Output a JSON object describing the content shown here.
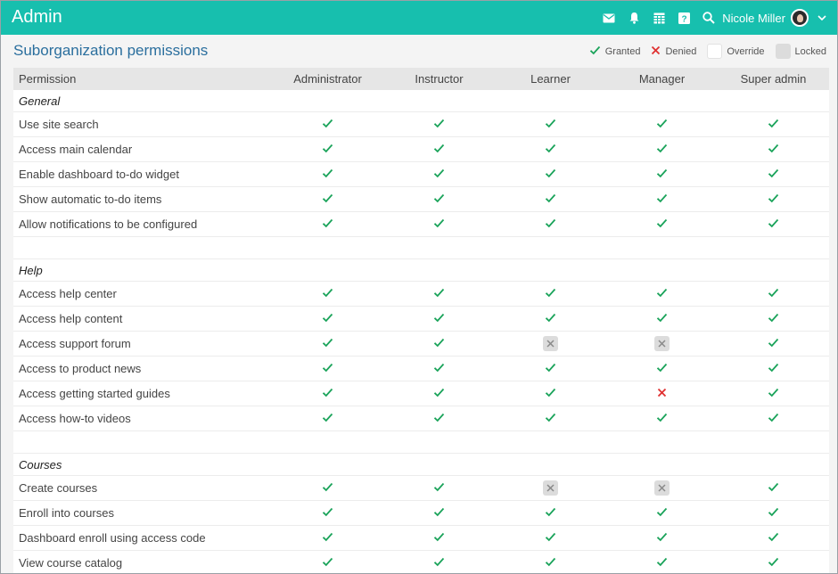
{
  "app": {
    "title": "Admin"
  },
  "header": {
    "icons": [
      "mail-icon",
      "bell-icon",
      "calendar-icon",
      "help-icon",
      "search-icon"
    ],
    "user_name": "Nicole Miller"
  },
  "page": {
    "title": "Suborganization permissions"
  },
  "legend": {
    "granted": "Granted",
    "denied": "Denied",
    "override": "Override",
    "locked": "Locked"
  },
  "colors": {
    "accent": "#17bfae",
    "title": "#2b6f9e",
    "granted": "#1aa35a",
    "denied": "#e03030",
    "locked": "#dcdcdc"
  },
  "table": {
    "header_permission": "Permission",
    "roles": [
      "Administrator",
      "Instructor",
      "Learner",
      "Manager",
      "Super admin"
    ],
    "sections": [
      {
        "name": "General",
        "rows": [
          {
            "label": "Use site search",
            "values": [
              "granted",
              "granted",
              "granted",
              "granted",
              "granted"
            ]
          },
          {
            "label": "Access main calendar",
            "values": [
              "granted",
              "granted",
              "granted",
              "granted",
              "granted"
            ]
          },
          {
            "label": "Enable dashboard to-do widget",
            "values": [
              "granted",
              "granted",
              "granted",
              "granted",
              "granted"
            ]
          },
          {
            "label": "Show automatic to-do items",
            "values": [
              "granted",
              "granted",
              "granted",
              "granted",
              "granted"
            ]
          },
          {
            "label": "Allow notifications to be configured",
            "values": [
              "granted",
              "granted",
              "granted",
              "granted",
              "granted"
            ]
          }
        ]
      },
      {
        "name": "Help",
        "rows": [
          {
            "label": "Access help center",
            "values": [
              "granted",
              "granted",
              "granted",
              "granted",
              "granted"
            ]
          },
          {
            "label": "Access help content",
            "values": [
              "granted",
              "granted",
              "granted",
              "granted",
              "granted"
            ]
          },
          {
            "label": "Access support forum",
            "values": [
              "granted",
              "granted",
              "locked",
              "locked",
              "granted"
            ]
          },
          {
            "label": "Access to product news",
            "values": [
              "granted",
              "granted",
              "granted",
              "granted",
              "granted"
            ]
          },
          {
            "label": "Access getting started guides",
            "values": [
              "granted",
              "granted",
              "granted",
              "denied",
              "granted"
            ]
          },
          {
            "label": "Access how-to videos",
            "values": [
              "granted",
              "granted",
              "granted",
              "granted",
              "granted"
            ]
          }
        ]
      },
      {
        "name": "Courses",
        "rows": [
          {
            "label": "Create courses",
            "values": [
              "granted",
              "granted",
              "locked",
              "locked",
              "granted"
            ]
          },
          {
            "label": "Enroll into courses",
            "values": [
              "granted",
              "granted",
              "granted",
              "granted",
              "granted"
            ]
          },
          {
            "label": "Dashboard enroll using access code",
            "values": [
              "granted",
              "granted",
              "granted",
              "granted",
              "granted"
            ]
          },
          {
            "label": "View course catalog",
            "values": [
              "granted",
              "granted",
              "granted",
              "granted",
              "granted"
            ]
          }
        ]
      }
    ]
  }
}
